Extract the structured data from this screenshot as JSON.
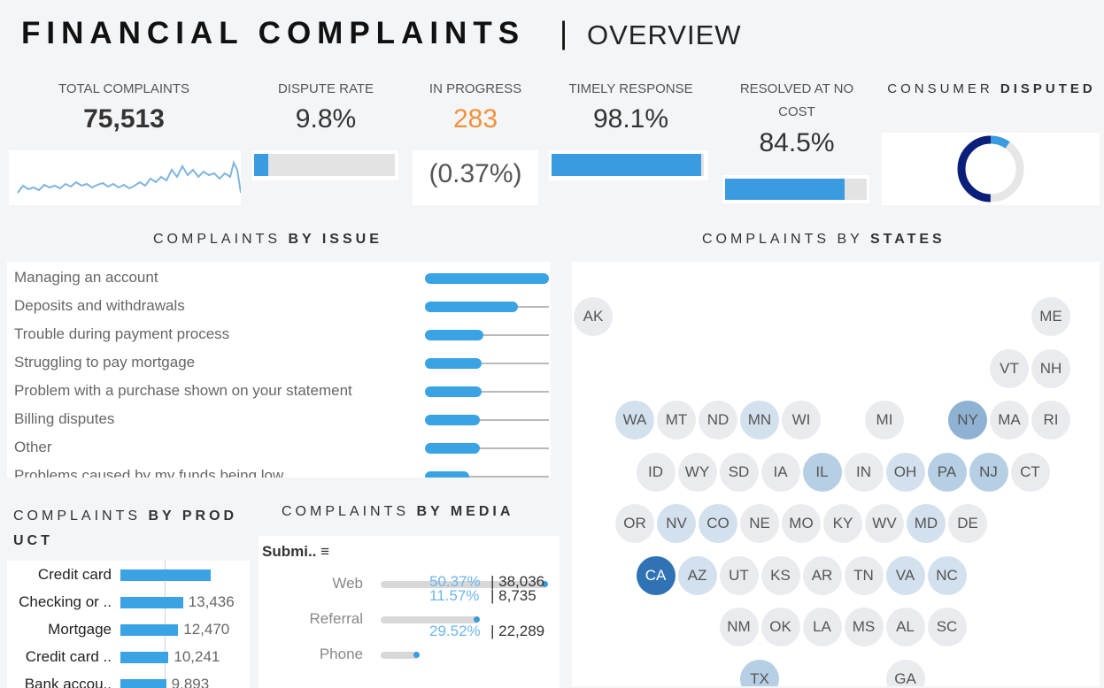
{
  "header": {
    "title": "FINANCIAL COMPLAINTS",
    "separator": "|",
    "subtitle": "OVERVIEW"
  },
  "kpis": {
    "total": {
      "label": "TOTAL COMPLAINTS",
      "value": "75,513"
    },
    "dispute_rate": {
      "label": "DISPUTE RATE",
      "value": "9.8%",
      "fill": 0.098
    },
    "in_progress": {
      "label": "IN PROGRESS",
      "value": "283",
      "sub": "(0.37%)",
      "color": "#f0923a"
    },
    "timely": {
      "label": "TIMELY RESPONSE",
      "value": "98.1%",
      "fill": 0.981
    },
    "resolved": {
      "label": "RESOLVED AT NO COST",
      "value": "84.5%",
      "fill": 0.845
    },
    "consumer_disputed": {
      "label_light": "CONSUMER ",
      "label_bold": "DISPUTED",
      "value": 0.098
    }
  },
  "sections": {
    "issue": {
      "light": "COMPLAINTS ",
      "bold": "BY ISSUE"
    },
    "states": {
      "light": "COMPLAINTS BY ",
      "bold": "STATES"
    },
    "product": {
      "light": "COMPLAINTS ",
      "bold": "BY PRODUCT"
    },
    "media": {
      "light": "COMPLAINTS ",
      "bold": "BY MEDIA"
    }
  },
  "issues": [
    {
      "label": "Managing an account",
      "value": 1.0
    },
    {
      "label": "Deposits and withdrawals",
      "value": 0.75
    },
    {
      "label": "Trouble during payment process",
      "value": 0.47
    },
    {
      "label": "Struggling to pay mortgage",
      "value": 0.46
    },
    {
      "label": "Problem with a purchase shown on your statement",
      "value": 0.46
    },
    {
      "label": "Billing disputes",
      "value": 0.44
    },
    {
      "label": "Other",
      "value": 0.44
    },
    {
      "label": "Problems caused by my funds being low",
      "value": 0.36
    }
  ],
  "states": [
    {
      "code": "AK",
      "row": 0,
      "col": 0,
      "shade": 0
    },
    {
      "code": "ME",
      "row": 0,
      "col": 11,
      "shade": 0
    },
    {
      "code": "VT",
      "row": 1,
      "col": 10,
      "shade": 0
    },
    {
      "code": "NH",
      "row": 1,
      "col": 11,
      "shade": 0
    },
    {
      "code": "WA",
      "row": 2,
      "col": 1,
      "shade": 1
    },
    {
      "code": "MT",
      "row": 2,
      "col": 2,
      "shade": 0
    },
    {
      "code": "ND",
      "row": 2,
      "col": 3,
      "shade": 0
    },
    {
      "code": "MN",
      "row": 2,
      "col": 4,
      "shade": 1
    },
    {
      "code": "WI",
      "row": 2,
      "col": 5,
      "shade": 0
    },
    {
      "code": "MI",
      "row": 2,
      "col": 7,
      "shade": 0
    },
    {
      "code": "NY",
      "row": 2,
      "col": 9,
      "shade": 3
    },
    {
      "code": "MA",
      "row": 2,
      "col": 10,
      "shade": 0
    },
    {
      "code": "RI",
      "row": 2,
      "col": 11,
      "shade": 0
    },
    {
      "code": "ID",
      "row": 3,
      "col": 1.5,
      "shade": 0
    },
    {
      "code": "WY",
      "row": 3,
      "col": 2.5,
      "shade": 0
    },
    {
      "code": "SD",
      "row": 3,
      "col": 3.5,
      "shade": 0
    },
    {
      "code": "IA",
      "row": 3,
      "col": 4.5,
      "shade": 0
    },
    {
      "code": "IL",
      "row": 3,
      "col": 5.5,
      "shade": 2
    },
    {
      "code": "IN",
      "row": 3,
      "col": 6.5,
      "shade": 0
    },
    {
      "code": "OH",
      "row": 3,
      "col": 7.5,
      "shade": 1
    },
    {
      "code": "PA",
      "row": 3,
      "col": 8.5,
      "shade": 2
    },
    {
      "code": "NJ",
      "row": 3,
      "col": 9.5,
      "shade": 2
    },
    {
      "code": "CT",
      "row": 3,
      "col": 10.5,
      "shade": 0
    },
    {
      "code": "OR",
      "row": 4,
      "col": 1,
      "shade": 0
    },
    {
      "code": "NV",
      "row": 4,
      "col": 2,
      "shade": 1
    },
    {
      "code": "CO",
      "row": 4,
      "col": 3,
      "shade": 1
    },
    {
      "code": "NE",
      "row": 4,
      "col": 4,
      "shade": 0
    },
    {
      "code": "MO",
      "row": 4,
      "col": 5,
      "shade": 0
    },
    {
      "code": "KY",
      "row": 4,
      "col": 6,
      "shade": 0
    },
    {
      "code": "WV",
      "row": 4,
      "col": 7,
      "shade": 0
    },
    {
      "code": "MD",
      "row": 4,
      "col": 8,
      "shade": 1
    },
    {
      "code": "DE",
      "row": 4,
      "col": 9,
      "shade": 0
    },
    {
      "code": "CA",
      "row": 5,
      "col": 1.5,
      "shade": 4
    },
    {
      "code": "AZ",
      "row": 5,
      "col": 2.5,
      "shade": 1
    },
    {
      "code": "UT",
      "row": 5,
      "col": 3.5,
      "shade": 0
    },
    {
      "code": "KS",
      "row": 5,
      "col": 4.5,
      "shade": 0
    },
    {
      "code": "AR",
      "row": 5,
      "col": 5.5,
      "shade": 0
    },
    {
      "code": "TN",
      "row": 5,
      "col": 6.5,
      "shade": 0
    },
    {
      "code": "VA",
      "row": 5,
      "col": 7.5,
      "shade": 1
    },
    {
      "code": "NC",
      "row": 5,
      "col": 8.5,
      "shade": 1
    },
    {
      "code": "NM",
      "row": 6,
      "col": 3.5,
      "shade": 0
    },
    {
      "code": "OK",
      "row": 6,
      "col": 4.5,
      "shade": 0
    },
    {
      "code": "LA",
      "row": 6,
      "col": 5.5,
      "shade": 0
    },
    {
      "code": "MS",
      "row": 6,
      "col": 6.5,
      "shade": 0
    },
    {
      "code": "AL",
      "row": 6,
      "col": 7.5,
      "shade": 0
    },
    {
      "code": "SC",
      "row": 6,
      "col": 8.5,
      "shade": 0
    },
    {
      "code": "TX",
      "row": 7,
      "col": 4,
      "shade": 2
    },
    {
      "code": "GA",
      "row": 7,
      "col": 7.5,
      "shade": 0
    }
  ],
  "state_colors": [
    "#e9ebee",
    "#d3e1ee",
    "#b6cfe4",
    "#8fb2d3",
    "#2f73b4"
  ],
  "products": [
    {
      "label": "Credit card",
      "value": "",
      "num": 0.75
    },
    {
      "label": "Checking or ..",
      "value": "13,436",
      "num": 0.52
    },
    {
      "label": "Mortgage",
      "value": "12,470",
      "num": 0.48
    },
    {
      "label": "Credit card ..",
      "value": "10,241",
      "num": 0.4
    },
    {
      "label": "Bank accou..",
      "value": "9,893",
      "num": 0.38
    }
  ],
  "media": {
    "header": "Submi..",
    "rows": [
      {
        "label": "Web",
        "pct": "50.37%",
        "count": "38,036",
        "fill": 1.0
      },
      {
        "label": "Referral",
        "pct": "29.52%",
        "count": "22,289",
        "fill": 0.59
      },
      {
        "label": "Phone",
        "pct": "11.57%",
        "count": "8,735",
        "fill": 0.23
      }
    ]
  }
}
